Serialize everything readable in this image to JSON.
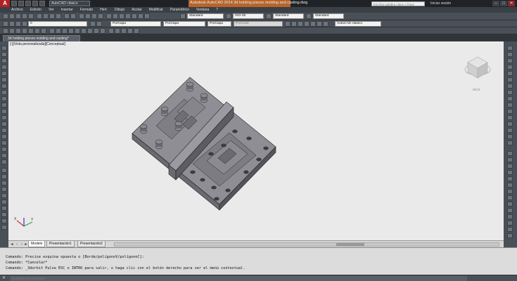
{
  "titlebar": {
    "logo": "A",
    "workspace": "AutoCAD clásico",
    "title": "Autodesk AutoCAD 2014   3d holding pieces molding and casting.dwg",
    "search_placeholder": "Escriba palabra clave o frase",
    "sign_in": "Iniciar sesión",
    "min": "–",
    "max": "□",
    "close": "✕"
  },
  "menu": [
    "Archivo",
    "Edición",
    "Ver",
    "Insertar",
    "Formato",
    "Herr.",
    "Dibujo",
    "Acotar",
    "Modificar",
    "Paramétrico",
    "Ventana",
    "?"
  ],
  "toolbar": {
    "text_style": "Standard",
    "dim_style": "ISO-25",
    "table_style": "Standard",
    "multileader_style": "Standard",
    "layer": "0",
    "color": "PorCapa",
    "linetype": "PorCapa",
    "lineweight": "PorCapa",
    "plot_style": "PorColor",
    "workspace_selector": "AutoCAD clásico"
  },
  "document_tab": "3d holding pieces molding and casting*",
  "viewport": {
    "label": "[-][Vista personalizada][Conceptual]",
    "viewcube_label": "WCS",
    "ucs_x": "X",
    "ucs_y": "Y"
  },
  "layout_tabs": [
    "Modelo",
    "Presentación1",
    "Presentación2"
  ],
  "command": {
    "history": [
      "Comando: Precise esquina opuesta o [Borde/polígonoV/polígonoC]:",
      "Comando: *Cancelar*",
      "Comando: _3dorbit Pulse ESC o INTRO para salir, o haga clic con el botón derecho para ver el menú contextual."
    ],
    "input_placeholder": "Escriba un comando"
  },
  "colors": {
    "viewport_bg": "#eaeaea",
    "ui_dark": "#4a5058",
    "title_highlight": "#b8642a",
    "model_top": "#8e8e94",
    "model_side": "#5c5c62"
  }
}
